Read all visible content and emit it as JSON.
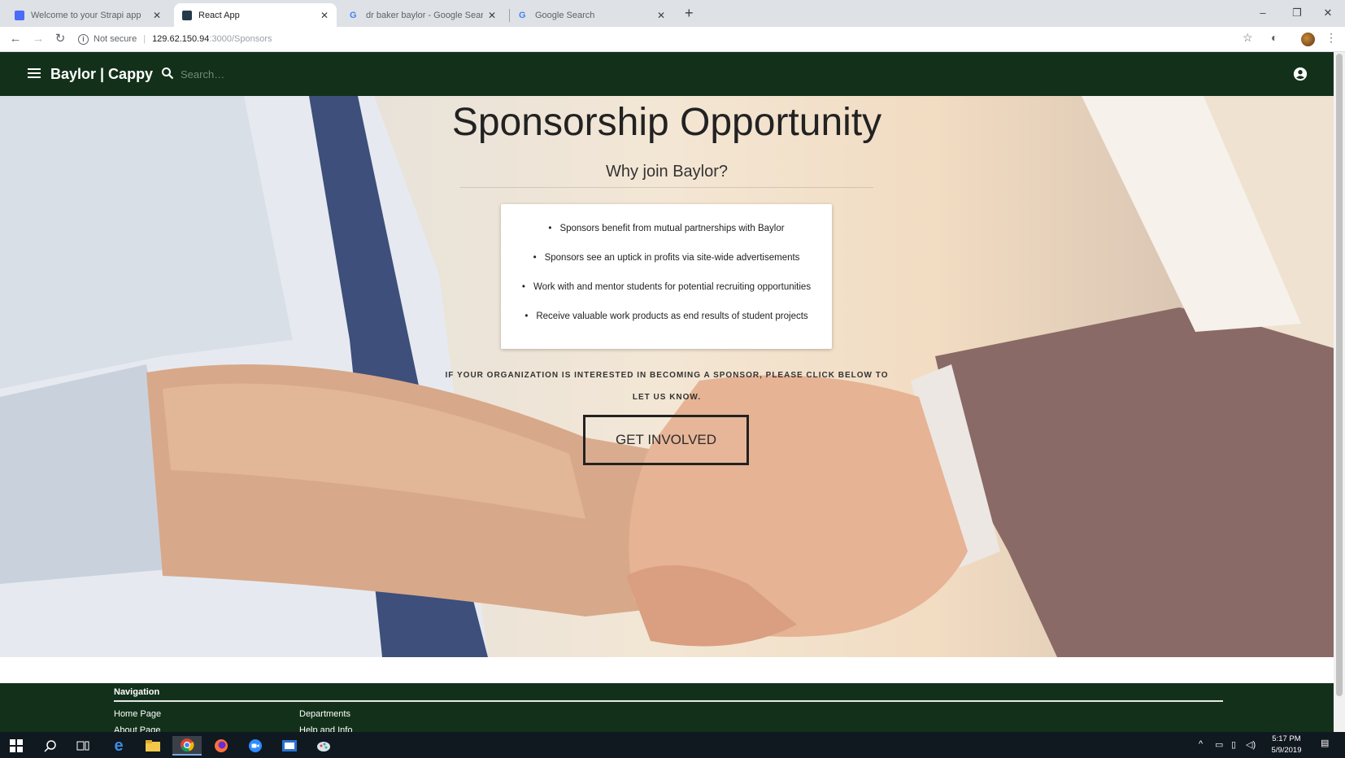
{
  "browser": {
    "tabs": [
      {
        "title": "Welcome to your Strapi app",
        "favicon": "strapi-icon",
        "active": false
      },
      {
        "title": "React App",
        "favicon": "react-icon",
        "active": true
      },
      {
        "title": "dr baker baylor - Google Search",
        "favicon": "google-icon",
        "active": false
      },
      {
        "title": "Google Search",
        "favicon": "google-icon",
        "active": false
      }
    ],
    "address": {
      "security_label": "Not secure",
      "host": "129.62.150.94",
      "path": ":3000/Sponsors"
    }
  },
  "appbar": {
    "brand": "Baylor | Cappy",
    "search_placeholder": "Search…"
  },
  "hero": {
    "title": "Sponsorship Opportunity",
    "subtitle": "Why join Baylor?",
    "benefits": [
      "Sponsors benefit from mutual partnerships with Baylor",
      "Sponsors see an uptick in profits via site-wide advertisements",
      "Work with and mentor students for potential recruiting opportunities",
      "Receive valuable work products as end results of student projects"
    ],
    "cta_text": "IF YOUR ORGANIZATION IS INTERESTED IN BECOMING A SPONSOR, PLEASE CLICK BELOW TO LET US KNOW.",
    "cta_button": "GET INVOLVED"
  },
  "footer": {
    "heading": "Navigation",
    "links_col1": [
      "Home Page",
      "About Page"
    ],
    "links_col2": [
      "Departments",
      "Help and Info"
    ]
  },
  "taskbar": {
    "time": "5:17 PM",
    "date": "5/9/2019"
  },
  "colors": {
    "appbar_bg": "#13311a",
    "footer_bg": "#13311a"
  }
}
